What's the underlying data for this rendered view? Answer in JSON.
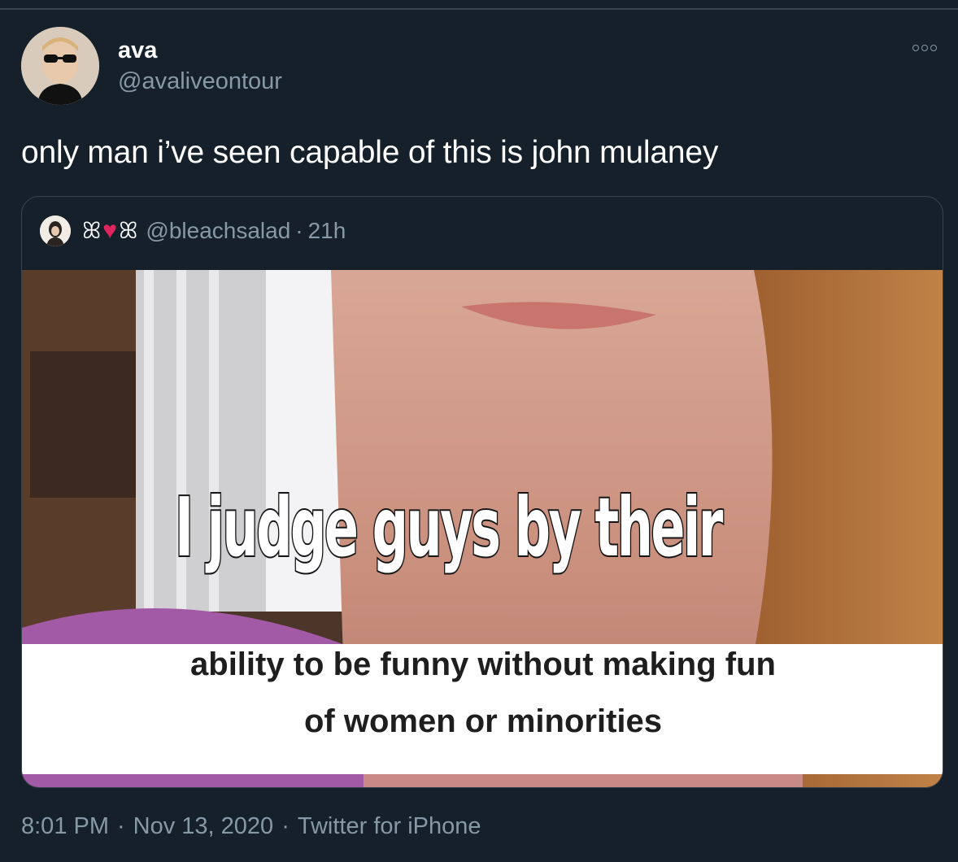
{
  "author": {
    "name": "ava",
    "handle": "@avaliveontour"
  },
  "tweet": {
    "text": "only man i’ve seen capable of this is john mulaney"
  },
  "quoted": {
    "name_left": "ꕤ",
    "name_right": "ꕤ",
    "heart": "♥",
    "handle": "@bleachsalad",
    "separator": "·",
    "time": "21h",
    "image": {
      "big_text": "I judge guys by their",
      "caption_line1": "ability to be funny without making fun",
      "caption_line2": "of women or minorities"
    }
  },
  "footer": {
    "time": "8:01 PM",
    "dot1": "·",
    "date": "Nov 13, 2020",
    "dot2": "·",
    "source": "Twitter for iPhone"
  },
  "colors": {
    "background": "#15202b",
    "secondary_text": "#8899a6",
    "border": "#38444d",
    "heart": "#e0245e"
  }
}
